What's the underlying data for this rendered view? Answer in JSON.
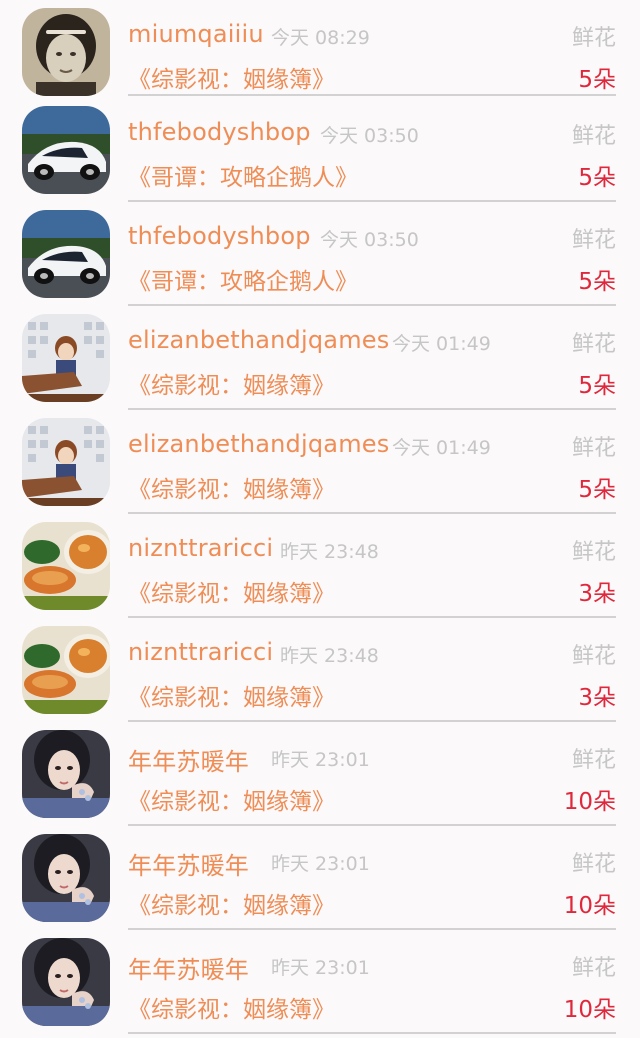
{
  "records": [
    {
      "user": "miumqaiiiu",
      "time": "今天 08:29",
      "gift": "鲜花",
      "book": "《综影视：姻缘簿》",
      "qty": "5朵",
      "avatar": "portrait-avatar"
    },
    {
      "user": "thfebodyshbop",
      "time": "今天 03:50",
      "gift": "鲜花",
      "book": "《哥谭：攻略企鹅人》",
      "qty": "5朵",
      "avatar": "car-avatar"
    },
    {
      "user": "thfebodyshbop",
      "time": "今天 03:50",
      "gift": "鲜花",
      "book": "《哥谭：攻略企鹅人》",
      "qty": "5朵",
      "avatar": "car-avatar"
    },
    {
      "user": "elizanbethandjqames",
      "time": "今天 01:49",
      "gift": "鲜花",
      "book": "《综影视：姻缘簿》",
      "qty": "5朵",
      "avatar": "anime-avatar"
    },
    {
      "user": "elizanbethandjqames",
      "time": "今天 01:49",
      "gift": "鲜花",
      "book": "《综影视：姻缘簿》",
      "qty": "5朵",
      "avatar": "anime-avatar"
    },
    {
      "user": "niznttraricci",
      "time": "昨天 23:48",
      "gift": "鲜花",
      "book": "《综影视：姻缘簿》",
      "qty": "3朵",
      "avatar": "food-avatar"
    },
    {
      "user": "niznttraricci",
      "time": "昨天 23:48",
      "gift": "鲜花",
      "book": "《综影视：姻缘簿》",
      "qty": "3朵",
      "avatar": "food-avatar"
    },
    {
      "user": "年年苏暖年",
      "time": "昨天 23:01",
      "gift": "鲜花",
      "book": "《综影视：姻缘簿》",
      "qty": "10朵",
      "avatar": "woman-avatar"
    },
    {
      "user": "年年苏暖年",
      "time": "昨天 23:01",
      "gift": "鲜花",
      "book": "《综影视：姻缘簿》",
      "qty": "10朵",
      "avatar": "woman-avatar"
    },
    {
      "user": "年年苏暖年",
      "time": "昨天 23:01",
      "gift": "鲜花",
      "book": "《综影视：姻缘簿》",
      "qty": "10朵",
      "avatar": "woman-avatar"
    }
  ],
  "colors": {
    "username": "#ef8d56",
    "muted": "#c6c6c6",
    "quantity": "#e0283c",
    "divider": "#d2d2d2",
    "background": "#fbf9fa"
  }
}
